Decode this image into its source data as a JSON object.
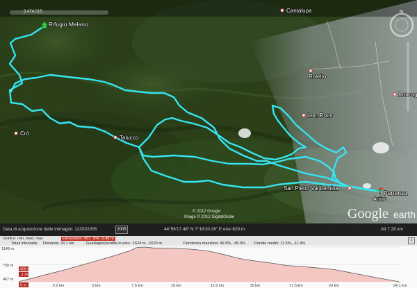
{
  "map": {
    "places": [
      {
        "name": "Cantalupa"
      },
      {
        "name": "Roletto"
      },
      {
        "name": "Roncaglia"
      },
      {
        "name": "Loc. Pons"
      },
      {
        "name": "Crò"
      },
      {
        "name": "Talucco"
      },
      {
        "name": "San Pietro Val Lemina"
      },
      {
        "name": "Rifugio Melano"
      },
      {
        "name": "Partenza"
      },
      {
        "name": "Arrivo"
      }
    ],
    "top_left_readout": "3.474.015",
    "copyright_line1": "© 2012 Google",
    "copyright_line2": "Image © 2012 DigitalGlobe",
    "brand": {
      "google": "Google",
      "earth": "earth"
    },
    "track_color": "#35e6f2"
  },
  "status": {
    "capture_date": "Data di acquisizione delle immagini: 12/20/2005",
    "year_badge": "2005",
    "coords": "44°56'17.48\" N   7°18'20.26\" E   elev   829 m",
    "altitude": "Alt   7.28 km"
  },
  "elevation": {
    "graph_label": "Grafico: min, med, max",
    "elev_highlight": "Elevazione: 457, 784, 1148 m",
    "totals_label": "Totali intervallo:",
    "distance": "Distanza: 24.1 km",
    "gain_loss": "Guadagno/perdita in elev.: 1624 m, -1623 m",
    "slope_max": "Pendenza massima: 46.9%, -45.0%",
    "slope_avg": "Pendio medio: 11.5%, -11.4%",
    "y_max": "1148 m",
    "y_mid": "750 m",
    "y_min": "457 m",
    "current_elev": "458 m",
    "current_slope": "-2.3%",
    "x_start": "0 m",
    "x_ticks": [
      "2.5 km",
      "5 km",
      "7.5 km",
      "10 km",
      "12.5 km",
      "15 km",
      "17.5 km",
      "20 km",
      "24.1 km"
    ]
  },
  "chart_data": {
    "type": "area",
    "xlabel": "",
    "ylabel": "",
    "xlim": [
      0,
      24.1
    ],
    "ylim": [
      457,
      1148
    ],
    "x": [
      0,
      1,
      2,
      3,
      4,
      5,
      6,
      7,
      7.5,
      8,
      8.5,
      9,
      10,
      11,
      12,
      13,
      13.5,
      14,
      15,
      16,
      17,
      18,
      19,
      20,
      21,
      22,
      23,
      24.1
    ],
    "y": [
      458,
      540,
      620,
      700,
      790,
      880,
      970,
      1070,
      1140,
      1148,
      1130,
      1125,
      1120,
      1105,
      1070,
      1000,
      960,
      920,
      870,
      830,
      780,
      760,
      730,
      700,
      640,
      580,
      520,
      458
    ]
  }
}
